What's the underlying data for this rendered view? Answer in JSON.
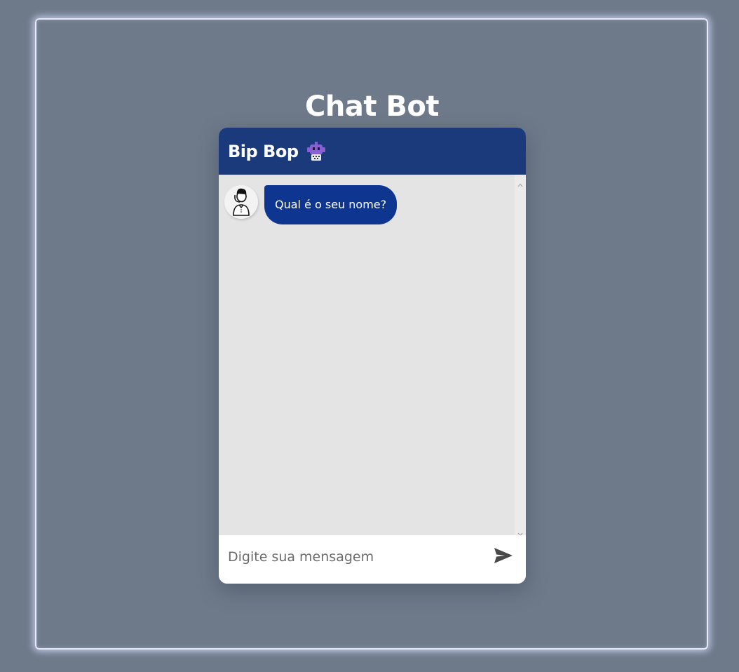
{
  "page": {
    "title": "Chat Bot"
  },
  "chat": {
    "header_title": "Bip Bop",
    "header_icon": "robot-icon",
    "messages": [
      {
        "sender": "bot",
        "avatar_icon": "person-avatar-icon",
        "text": "Qual é o seu nome?"
      }
    ],
    "input": {
      "value": "",
      "placeholder": "Digite sua mensagem"
    },
    "send_icon": "send-icon"
  },
  "colors": {
    "background": "#6e7a8a",
    "header": "#1a3a7c",
    "bubble": "#0e3690",
    "chat_body": "#e4e4e4",
    "frame_glow": "#e6e8f5"
  }
}
